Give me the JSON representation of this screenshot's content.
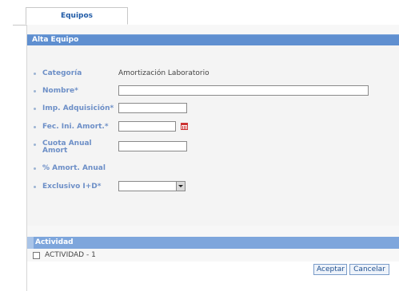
{
  "tabs": [
    {
      "label": "Equipos",
      "active": true
    }
  ],
  "form": {
    "title": "Alta Equipo",
    "fields": {
      "categoria": {
        "label": "Categoría",
        "value": "Amortización Laboratorio"
      },
      "nombre": {
        "label": "Nombre*",
        "value": ""
      },
      "imp_adquisicion": {
        "label": "Imp. Adquisición*",
        "value": ""
      },
      "fec_ini_amort": {
        "label": "Fec. Ini. Amort.*",
        "value": ""
      },
      "cuota_anual_amort": {
        "label_line1": "Cuota Anual",
        "label_line2": "Amort",
        "value": ""
      },
      "pct_amort_anual": {
        "label": "% Amort. Anual"
      },
      "exclusivo_id": {
        "label": "Exclusivo I+D*",
        "selected": ""
      }
    }
  },
  "activity": {
    "header": "Actividad",
    "items": [
      {
        "label": "ACTIVIDAD - 1",
        "checked": false
      }
    ]
  },
  "buttons": {
    "accept": "Aceptar",
    "cancel": "Cancelar"
  },
  "colors": {
    "header_bar": "#5f8fd0",
    "label": "#6d8fc7",
    "tab_text": "#1f5aa6",
    "calendar": "#cc3333"
  }
}
